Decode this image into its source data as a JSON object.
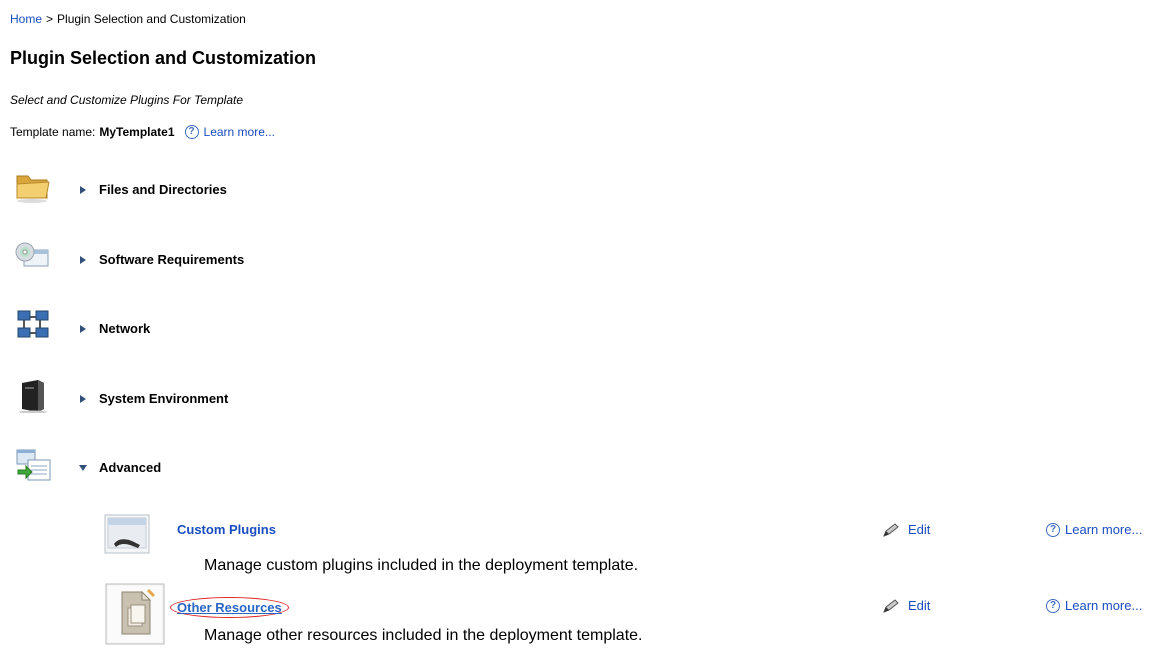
{
  "breadcrumb": {
    "home": "Home",
    "separator": ">",
    "current": "Plugin Selection and Customization"
  },
  "page_title": "Plugin Selection and Customization",
  "subtitle": "Select and Customize Plugins For Template",
  "template": {
    "label": "Template name:",
    "name": "MyTemplate1",
    "learn_more": "Learn more..."
  },
  "categories": [
    {
      "label": "Files and Directories",
      "icon": "folder-icon",
      "expanded": false
    },
    {
      "label": "Software Requirements",
      "icon": "software-cd-icon",
      "expanded": false
    },
    {
      "label": "Network",
      "icon": "network-icon",
      "expanded": false
    },
    {
      "label": "System Environment",
      "icon": "server-tower-icon",
      "expanded": false
    },
    {
      "label": "Advanced",
      "icon": "advanced-settings-icon",
      "expanded": true
    }
  ],
  "advanced_items": [
    {
      "name": "Custom Plugins",
      "description": "Manage custom plugins included in the deployment template.",
      "edit": "Edit",
      "learn_more": "Learn more..."
    },
    {
      "name": "Other Resources",
      "description": "Manage other resources included in the deployment template.",
      "edit": "Edit",
      "learn_more": "Learn more..."
    }
  ],
  "help_glyph": "?",
  "colors": {
    "link": "#1a4dbf",
    "highlight_circle": "#dd2222",
    "expander": "#33507a"
  }
}
